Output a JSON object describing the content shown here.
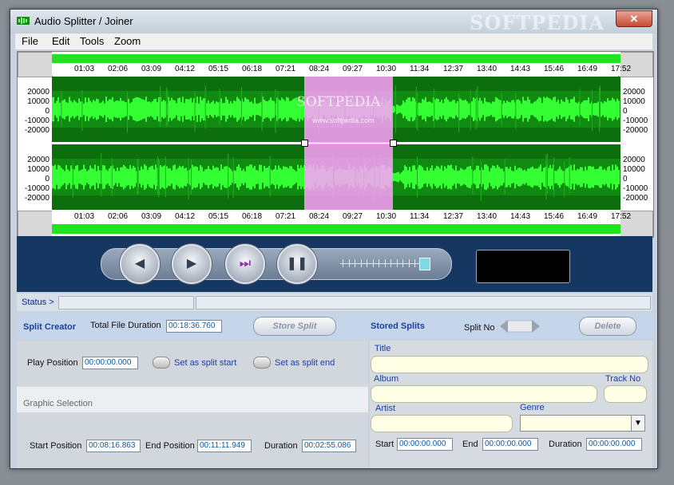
{
  "window": {
    "title": "Audio Splitter / Joiner",
    "watermark": "SOFTPEDIA",
    "close_symbol": "✕"
  },
  "menu": [
    "File",
    "Edit",
    "Tools",
    "Zoom"
  ],
  "timeline": {
    "ticks": [
      "01:03",
      "02:06",
      "03:09",
      "04:12",
      "05:15",
      "06:18",
      "07:21",
      "08:24",
      "09:27",
      "10:30",
      "11:34",
      "12:37",
      "13:40",
      "14:43",
      "15:46",
      "16:49",
      "17:52"
    ],
    "y_labels": [
      "20000",
      "10000",
      "0",
      "-10000",
      "-20000"
    ],
    "selection_start_fraction": 0.444,
    "selection_end_fraction": 0.6,
    "watermark_text": "SOFTPEDIA",
    "watermark_url": "www.softpedia.com"
  },
  "transport": {
    "icons": [
      "rewind-icon",
      "play-icon",
      "step-forward-icon",
      "pause-icon"
    ],
    "glyphs": [
      "◀",
      "▶",
      "⏭",
      "❚❚"
    ],
    "volume_level": 0.9
  },
  "status": {
    "label": "Status >"
  },
  "split_creator": {
    "title": "Split Creator",
    "total_duration_label": "Total File Duration",
    "total_duration_value": "00:18:36.760",
    "store_split_button": "Store Split",
    "stored_splits_title": "Stored Splits",
    "split_no_label": "Split No",
    "delete_button": "Delete"
  },
  "play": {
    "position_label": "Play Position",
    "position_value": "00:00:00.000",
    "set_start_label": "Set as split start",
    "set_end_label": "Set as split end"
  },
  "graphic_selection": {
    "title": "Graphic Selection",
    "start_label": "Start Position",
    "start_value": "00:08:16.863",
    "end_label": "End Position",
    "end_value": "00:11:11.949",
    "duration_label": "Duration",
    "duration_value": "00:02:55.086"
  },
  "tags": {
    "title_label": "Title",
    "album_label": "Album",
    "track_label": "Track No",
    "artist_label": "Artist",
    "genre_label": "Genre",
    "start_label": "Start",
    "start_value": "00:00:00.000",
    "end_label": "End",
    "end_value": "00:00:00.000",
    "duration_label": "Duration",
    "duration_value": "00:00:00.000"
  },
  "colors": {
    "waveform_bg": "#0d6e0d",
    "waveform_signal": "#33ff33",
    "selection": "#ff9cff",
    "transport_bg": "#163762"
  }
}
